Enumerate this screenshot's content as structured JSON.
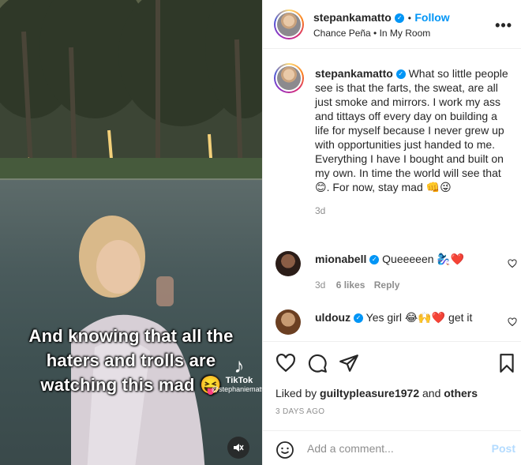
{
  "video": {
    "caption_lines": [
      "And knowing that all the",
      "haters and trolls are",
      "watching this mad 😝"
    ],
    "tiktok_brand": "TikTok",
    "tiktok_handle": "@stephaniematto"
  },
  "header": {
    "username": "stepankamatto",
    "follow_label": "Follow",
    "separator": "•",
    "audio": "Chance Peña • In My Room",
    "more_label": "•••"
  },
  "caption": {
    "username": "stepankamatto",
    "text": "What so little people see is that the farts, the sweat, are all just smoke and mirrors. I work my ass and tittays off every day on building a life for myself because I never grew up with opportunities just handed to me. Everything I have I bought and built on my own. In time the world will see that 😊. For now, stay mad 👊😜",
    "time": "3d"
  },
  "comments": [
    {
      "username": "mionabell",
      "text": "Queeeeen 🧞‍♀️❤️",
      "time": "3d",
      "likes": "6 likes",
      "reply": "Reply"
    },
    {
      "username": "uldouz",
      "text": "Yes girl 😂🙌❤️ get it"
    }
  ],
  "footer": {
    "liked_by_prefix": "Liked by",
    "liked_by_user": "guiltypleasure1972",
    "liked_by_and": "and",
    "liked_by_others": "others",
    "date": "3 DAYS AGO",
    "comment_placeholder": "Add a comment...",
    "post_label": "Post"
  },
  "colors": {
    "accent": "#0095f6",
    "heart": "#ed4956",
    "muted": "#8e8e8e",
    "post_disabled": "#b3dbff"
  }
}
